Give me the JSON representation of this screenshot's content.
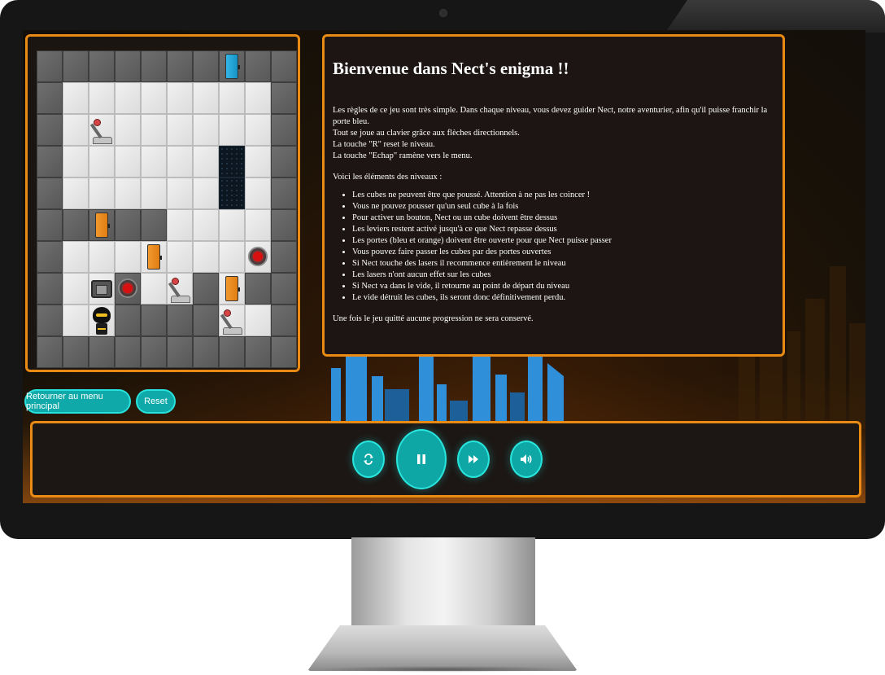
{
  "game": {
    "title": "Bienvenue dans Nect's enigma !!",
    "intro": [
      "Les règles de ce jeu sont très simple. Dans chaque niveau, vous devez guider Nect, notre aventurier, afin qu'il puisse franchir la porte bleu.",
      "Tout se joue au clavier grâce aux flèches directionnels.",
      "La touche \"R\" reset le niveau.",
      "La touche \"Echap\" ramène vers le menu."
    ],
    "elements_heading": "Voici les éléments des niveaux :",
    "rules": [
      "Les cubes ne peuvent être que poussé. Attention à ne pas les coincer !",
      "Vous ne pouvez pousser qu'un seul cube à la fois",
      "Pour activer un bouton, Nect ou un cube doivent être dessus",
      "Les leviers restent activé jusqu'à ce que Nect repasse dessus",
      "Les portes (bleu et orange) doivent être ouverte pour que Nect puisse passer",
      "Vous pouvez faire passer les cubes par des portes ouvertes",
      "Si Nect touche des lasers il recommence entièrement le niveau",
      "Les lasers n'ont aucun effet sur les cubes",
      "Si Nect va dans le vide, il retourne au point de départ du niveau",
      "Le vide détruit les cubes, ils seront donc définitivement perdu."
    ],
    "footer_note": "Une fois le jeu quitté aucune progression ne sera conservé."
  },
  "controls": {
    "main_menu_label": "Retourner au menu principal",
    "reset_label": "Reset"
  },
  "player": {
    "buttons": [
      "repeat-icon",
      "pause-icon",
      "fast-forward-icon",
      "volume-icon"
    ]
  },
  "board": {
    "rows": [
      "WWWWWWWWWW",
      "WFFFFFFFFW",
      "WFFFFFFFFW",
      "WFFFFFFVFW",
      "WFFFFFFVFW",
      "WWWWWFFFFW",
      "WFFFFFFFFW",
      "WFFWFFWFWW",
      "WFFWWWWFFW",
      "WWWWWWWWWW"
    ],
    "objects": [
      {
        "type": "door-blue",
        "row": 0,
        "col": 7
      },
      {
        "type": "lever",
        "row": 2,
        "col": 2
      },
      {
        "type": "door-orange",
        "row": 5,
        "col": 2
      },
      {
        "type": "door-orange",
        "row": 6,
        "col": 4
      },
      {
        "type": "button",
        "row": 6,
        "col": 8
      },
      {
        "type": "laser",
        "row": 7,
        "col": 2
      },
      {
        "type": "button",
        "row": 7,
        "col": 3
      },
      {
        "type": "lever",
        "row": 7,
        "col": 5
      },
      {
        "type": "door-orange",
        "row": 7,
        "col": 7
      },
      {
        "type": "nect",
        "row": 8,
        "col": 2
      },
      {
        "type": "lever",
        "row": 8,
        "col": 7
      }
    ]
  },
  "colors": {
    "accent_border": "#e88a14",
    "button_teal": "#10a9a9",
    "button_outline": "#27e2dc",
    "door_orange": "#f29a2e",
    "door_blue": "#33b6e6"
  }
}
